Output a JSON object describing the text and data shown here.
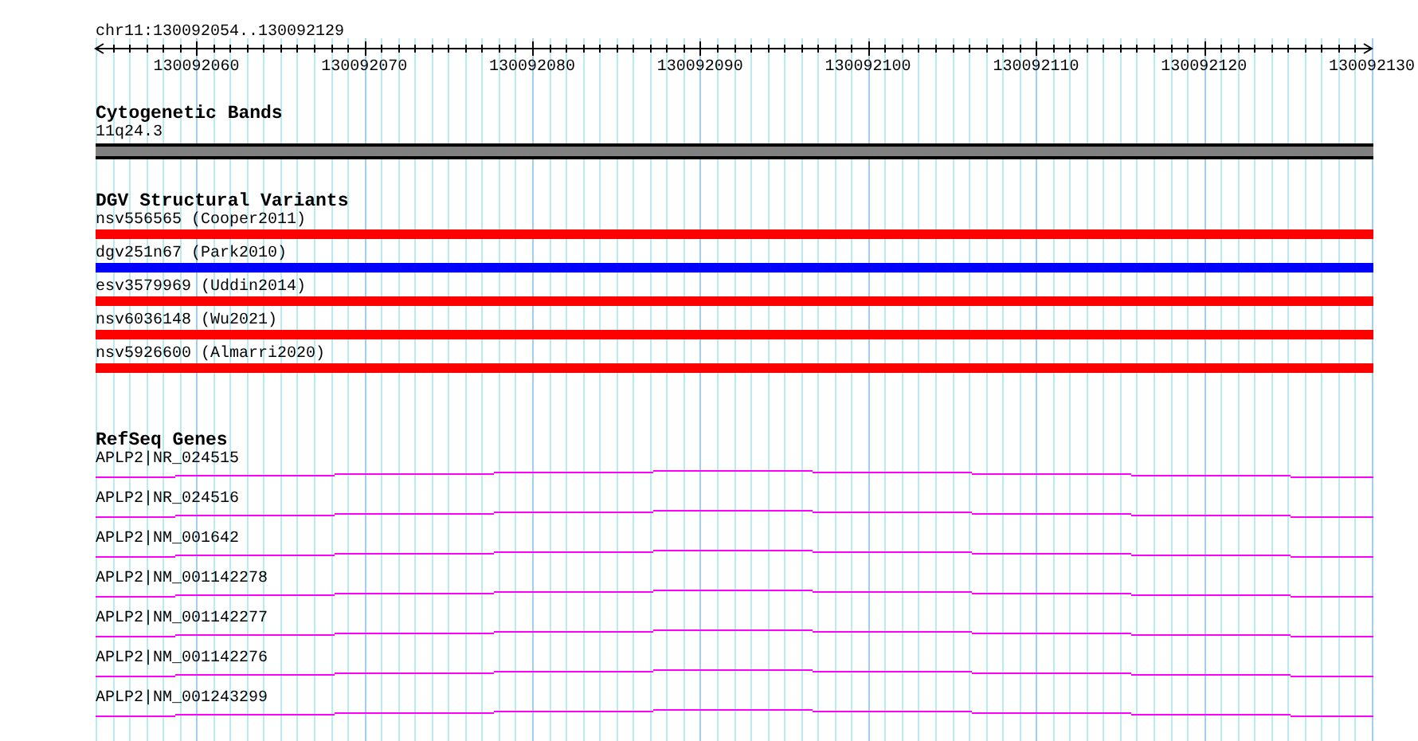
{
  "ruler": {
    "location": "chr11:130092054..130092129",
    "tick_labels": [
      "130092060",
      "130092070",
      "130092080",
      "130092090",
      "130092100",
      "130092110",
      "130092120",
      "130092130"
    ]
  },
  "cytogenetic_bands": {
    "title": "Cytogenetic Bands",
    "items": [
      {
        "label": "11q24.3",
        "color": "#808080"
      }
    ]
  },
  "dgv_structural_variants": {
    "title": "DGV Structural Variants",
    "items": [
      {
        "label": "nsv556565 (Cooper2011)",
        "color": "#ff0000"
      },
      {
        "label": "dgv251n67 (Park2010)",
        "color": "#0000ff"
      },
      {
        "label": "esv3579969 (Uddin2014)",
        "color": "#ff0000"
      },
      {
        "label": "nsv6036148 (Wu2021)",
        "color": "#ff0000"
      },
      {
        "label": "nsv5926600 (Almarri2020)",
        "color": "#ff0000"
      }
    ]
  },
  "refseq_genes": {
    "title": "RefSeq Genes",
    "items": [
      {
        "label": "APLP2|NR_024515"
      },
      {
        "label": "APLP2|NR_024516"
      },
      {
        "label": "APLP2|NM_001642"
      },
      {
        "label": "APLP2|NM_001142278"
      },
      {
        "label": "APLP2|NM_001142277"
      },
      {
        "label": "APLP2|NM_001142276"
      },
      {
        "label": "APLP2|NM_001243299"
      }
    ]
  }
}
